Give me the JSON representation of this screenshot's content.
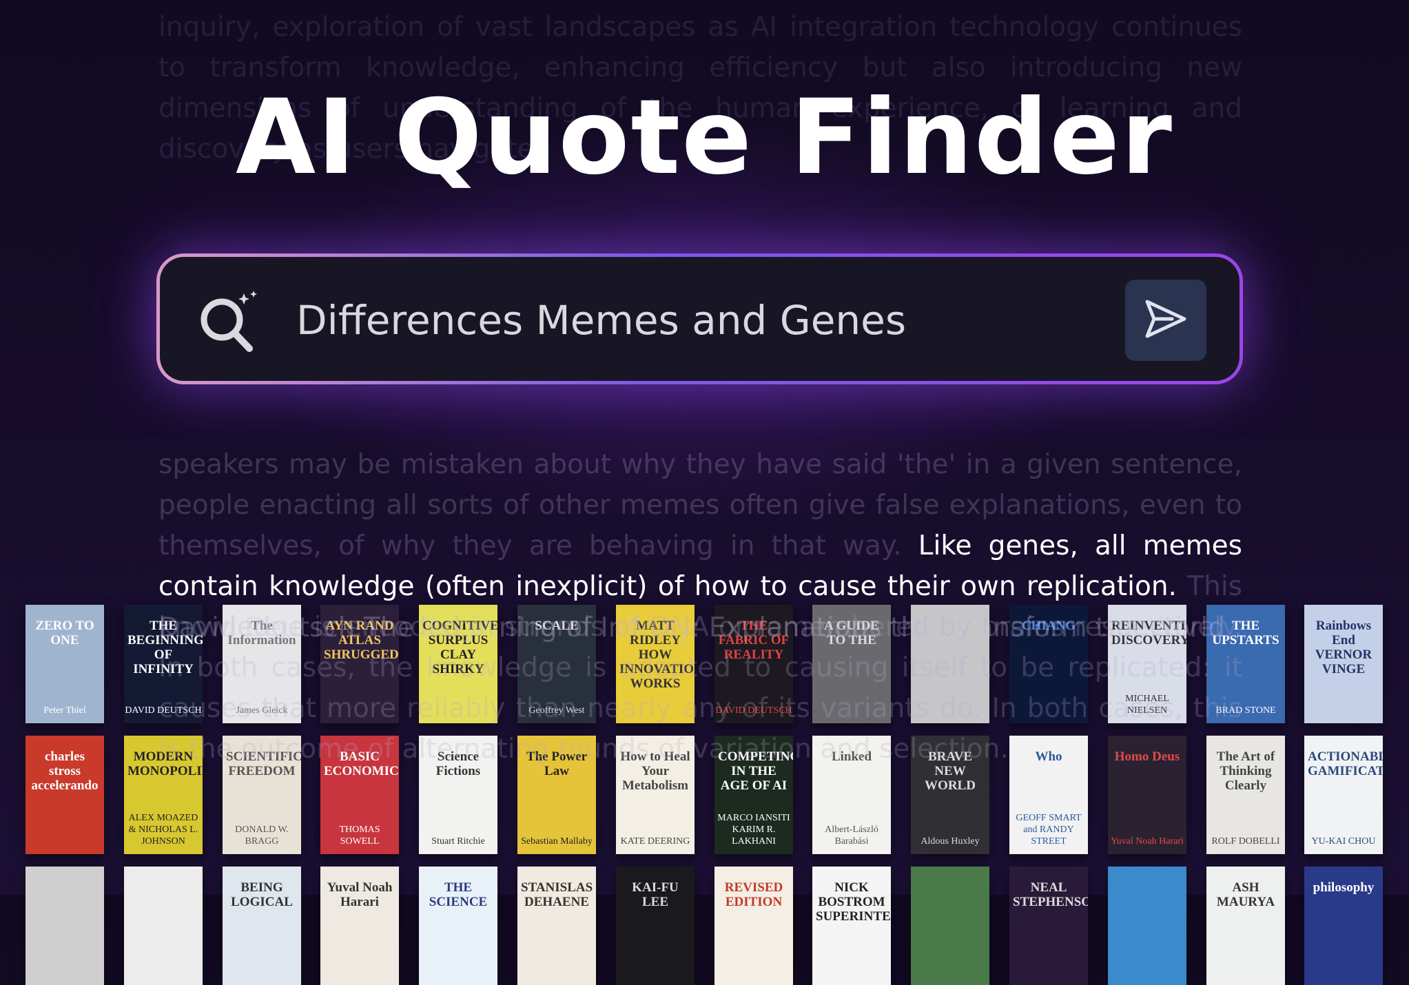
{
  "title": "AI Quote Finder",
  "search": {
    "value": "Differences Memes and Genes",
    "icon": "ai-search-icon",
    "submit_icon": "send-icon"
  },
  "background_text": "inquiry, exploration of vast landscapes as AI integration technology continues to transform knowledge, enhancing efficiency but also introducing new dimensions of understanding of the human experience, of learning and discovery as users navigate",
  "quote": {
    "before": "speakers may be mistaken about why they have said 'the' in a given sentence, people enacting all sorts of other memes often give false explanations, even to themselves, of why they are behaving in that way.",
    "highlight": "Like genes, all memes contain knowledge (often inexplicit) of how to cause their own replication.",
    "after": "This knowledge is encoded in strands of DNA or remembered by brains respectively. In both cases, the knowledge is adapted to causing itself to be replicated: it causes that more reliably than nearly any of its variants do. In both cases, this is the outcome of alternating rounds of variation and selection."
  },
  "shelf_overlay_text": "David Deutsch The Beginning of Infinity: Explanations that Transform the World",
  "books": [
    {
      "title": "ZERO TO ONE",
      "author": "Peter Thiel",
      "bg": "#9fb5cf",
      "fg": "#ffffff"
    },
    {
      "title": "THE BEGINNING OF INFINITY",
      "author": "DAVID DEUTSCH",
      "bg": "#141a34",
      "fg": "#ffffff"
    },
    {
      "title": "The Information",
      "author": "James Gleick",
      "bg": "#e6e6e8",
      "fg": "#777777"
    },
    {
      "title": "AYN RAND ATLAS SHRUGGED",
      "author": "",
      "bg": "#2c1f3a",
      "fg": "#f0c860"
    },
    {
      "title": "COGNITIVE SURPLUS CLAY SHIRKY",
      "author": "",
      "bg": "#e4df5a",
      "fg": "#222222"
    },
    {
      "title": "SCALE",
      "author": "Geoffrey West",
      "bg": "#28303c",
      "fg": "#dddddd"
    },
    {
      "title": "MATT RIDLEY HOW INNOVATION WORKS",
      "author": "",
      "bg": "#e8cc3a",
      "fg": "#333333"
    },
    {
      "title": "THE FABRIC OF REALITY",
      "author": "DAVID DEUTSCH",
      "bg": "#1c1a20",
      "fg": "#e04444"
    },
    {
      "title": "A GUIDE TO THE",
      "author": "",
      "bg": "#6a6a6e",
      "fg": "#dddddd"
    },
    {
      "title": "",
      "author": "",
      "bg": "#c6c6c8",
      "fg": "#333333"
    },
    {
      "title": "CHIANG",
      "author": "",
      "bg": "#0c1838",
      "fg": "#4a8ae8"
    },
    {
      "title": "REINVENTING DISCOVERY",
      "author": "MICHAEL NIELSEN",
      "bg": "#d8dde8",
      "fg": "#333333"
    },
    {
      "title": "THE UPSTARTS",
      "author": "BRAD STONE",
      "bg": "#3a6ab0",
      "fg": "#ffffff"
    },
    {
      "title": "Rainbows End VERNOR VINGE",
      "author": "",
      "bg": "#c4d0e8",
      "fg": "#223366"
    },
    {
      "title": "charles stross accelerando",
      "author": "",
      "bg": "#c93a2a",
      "fg": "#ffffff"
    },
    {
      "title": "MODERN MONOPOLIES",
      "author": "ALEX MOAZED & NICHOLAS L. JOHNSON",
      "bg": "#d8c830",
      "fg": "#222222"
    },
    {
      "title": "SCIENTIFIC FREEDOM",
      "author": "DONALD W. BRAGG",
      "bg": "#e8e2d6",
      "fg": "#555555"
    },
    {
      "title": "BASIC ECONOMICS",
      "author": "THOMAS SOWELL",
      "bg": "#c8353e",
      "fg": "#ffffff"
    },
    {
      "title": "Science Fictions",
      "author": "Stuart Ritchie",
      "bg": "#f2f2f0",
      "fg": "#333333"
    },
    {
      "title": "The Power Law",
      "author": "Sebastian Mallaby",
      "bg": "#e6c43a",
      "fg": "#222222"
    },
    {
      "title": "How to Heal Your Metabolism",
      "author": "KATE DEERING",
      "bg": "#f4efe4",
      "fg": "#444444"
    },
    {
      "title": "COMPETING IN THE AGE OF AI",
      "author": "MARCO IANSITI KARIM R. LAKHANI",
      "bg": "#1c2a20",
      "fg": "#ffffff"
    },
    {
      "title": "Linked",
      "author": "Albert-László Barabási",
      "bg": "#f2f2ee",
      "fg": "#555555"
    },
    {
      "title": "BRAVE NEW WORLD",
      "author": "Aldous Huxley",
      "bg": "#302f34",
      "fg": "#dddddd"
    },
    {
      "title": "Who",
      "author": "GEOFF SMART and RANDY STREET",
      "bg": "#f2f2f2",
      "fg": "#2a5a9a"
    },
    {
      "title": "Homo Deus",
      "author": "Yuval Noah Harari",
      "bg": "#2a2230",
      "fg": "#e04a4a"
    },
    {
      "title": "The Art of Thinking Clearly",
      "author": "ROLF DOBELLI",
      "bg": "#e8e6e2",
      "fg": "#444444"
    },
    {
      "title": "ACTIONABLE GAMIFICATION",
      "author": "YU-KAI CHOU",
      "bg": "#f0f2f4",
      "fg": "#2a4a7a"
    },
    {
      "title": "",
      "author": "",
      "bg": "#cfcfcf",
      "fg": "#333333"
    },
    {
      "title": "",
      "author": "",
      "bg": "#ececec",
      "fg": "#333333"
    },
    {
      "title": "BEING LOGICAL",
      "author": "",
      "bg": "#dfe6ee",
      "fg": "#333333"
    },
    {
      "title": "Yuval Noah Harari",
      "author": "",
      "bg": "#eeeae2",
      "fg": "#333333"
    },
    {
      "title": "THE SCIENCE",
      "author": "",
      "bg": "#e8f0f8",
      "fg": "#2a3a7a"
    },
    {
      "title": "STANISLAS DEHAENE",
      "author": "",
      "bg": "#f0eae0",
      "fg": "#333333"
    },
    {
      "title": "KAI-FU LEE",
      "author": "",
      "bg": "#1a1a1e",
      "fg": "#dddddd"
    },
    {
      "title": "REVISED EDITION",
      "author": "",
      "bg": "#f4eee4",
      "fg": "#c03a2a"
    },
    {
      "title": "NICK BOSTROM SUPERINTELLIGENCE",
      "author": "",
      "bg": "#f4f4f4",
      "fg": "#222222"
    },
    {
      "title": "",
      "author": "",
      "bg": "#4a7a4a",
      "fg": "#ffffff"
    },
    {
      "title": "NEAL STEPHENSON",
      "author": "",
      "bg": "#2a1a3a",
      "fg": "#dddddd"
    },
    {
      "title": "",
      "author": "",
      "bg": "#3a8acc",
      "fg": "#ffffff"
    },
    {
      "title": "ASH MAURYA",
      "author": "",
      "bg": "#eef0f0",
      "fg": "#333333"
    },
    {
      "title": "philosophy",
      "author": "",
      "bg": "#2a3a8a",
      "fg": "#ffffff"
    }
  ]
}
